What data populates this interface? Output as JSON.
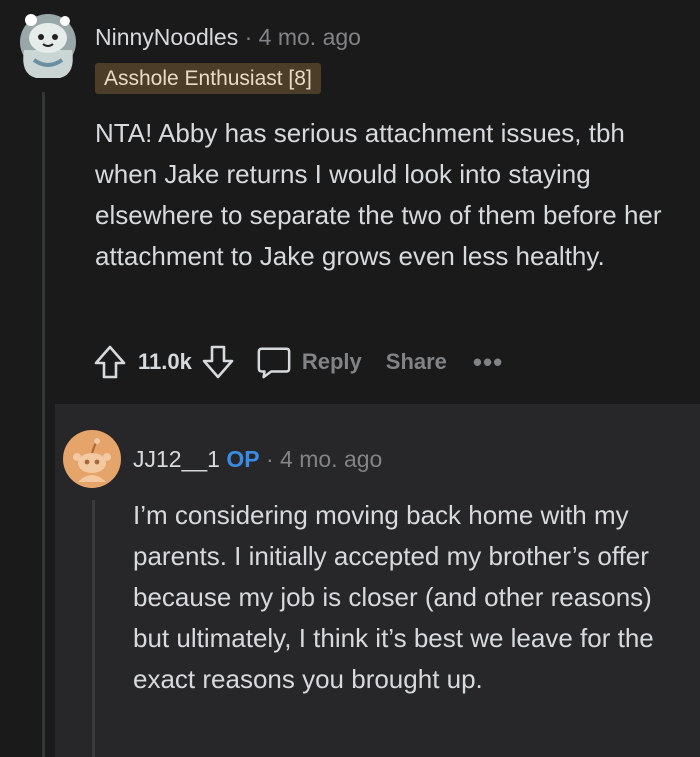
{
  "comment": {
    "author": "NinnyNoodles",
    "separator": "·",
    "time": "4 mo. ago",
    "flair": "Asshole Enthusiast [8]",
    "body": "NTA! Abby has serious attachment issues, tbh when Jake returns I would look into staying elsewhere to separate the two of them before her attachment to Jake grows even less healthy.",
    "votes": "11.0k",
    "reply_label": "Reply",
    "share_label": "Share",
    "more_label": "•••"
  },
  "reply": {
    "author": "JJ12__1",
    "op_badge": "OP",
    "separator": "·",
    "time": "4 mo. ago",
    "body": "I’m considering moving back home with my parents. I initially accepted my brother’s offer because my job is closer (and other reasons) but ultimately, I think it’s best we leave for the exact reasons you brought up."
  },
  "icons": {
    "upvote": "upvote-arrow-icon",
    "downvote": "downvote-arrow-icon",
    "reply": "speech-bubble-icon",
    "avatar1": "snoo-avatar-icon",
    "avatar2": "snoo-avatar-icon"
  },
  "colors": {
    "background": "#1a1a1b",
    "reply_background": "#272729",
    "flair_background": "#4b3d27",
    "op_badge": "#3a8ce3",
    "muted": "#818384"
  }
}
